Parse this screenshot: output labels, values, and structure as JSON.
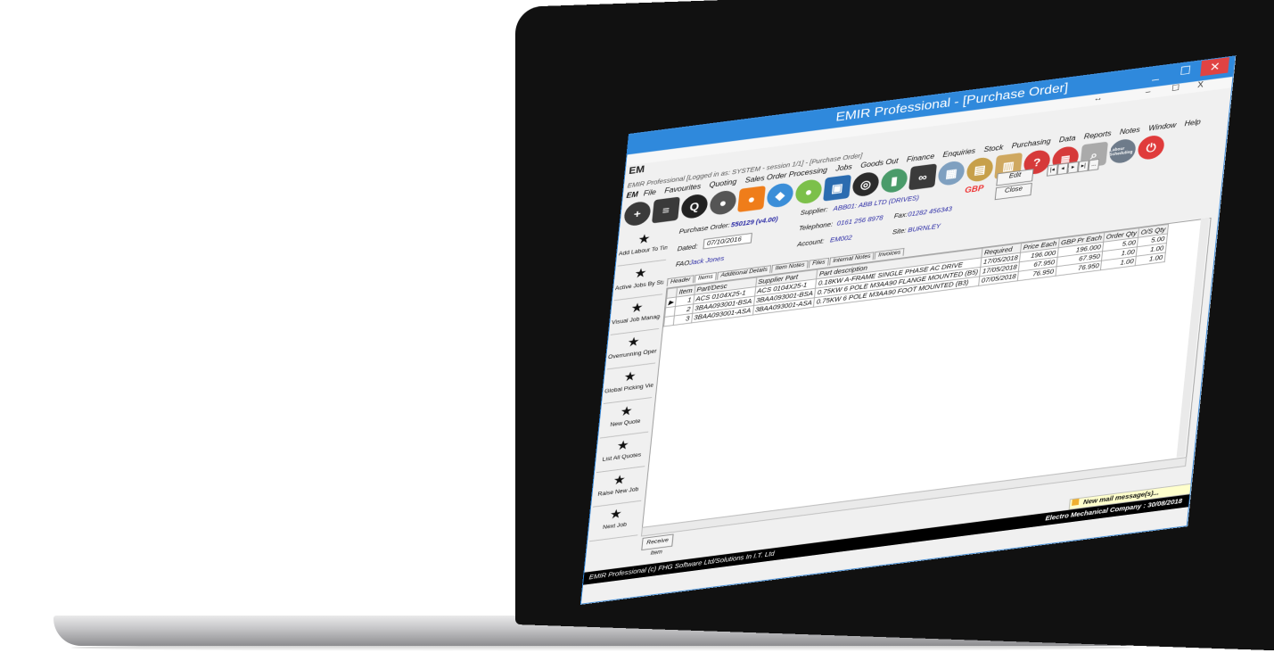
{
  "window": {
    "title": "EMIR Professional - [Purchase Order]",
    "controls": [
      "_",
      "☐",
      "✕"
    ],
    "inner_controls": [
      "↔",
      "–",
      "☐",
      "X"
    ],
    "session_info": "EMIR Professional [Logged in as: SYSTEM - session 1/1] - [Purchase Order]",
    "logo_text": "EM"
  },
  "menu": [
    "File",
    "Favourites",
    "Quoting",
    "Sales Order Processing",
    "Jobs",
    "Goods Out",
    "Finance",
    "Enquiries",
    "Stock",
    "Purchasing",
    "Data",
    "Reports",
    "Notes",
    "Window",
    "Help"
  ],
  "toolbar": {
    "colors": [
      "#3a3a3a",
      "#3a3a3a",
      "#222",
      "#555",
      "#ef7d1a",
      "#3b8ed8",
      "#7cc04a",
      "#2b6cb0",
      "#2b2b2b",
      "#4a9b6a",
      "#3a3a3a",
      "#7fa0c0",
      "#c7a04a",
      "#cfa860",
      "#d63a3a",
      "#d63a3a",
      "#aaaaaa",
      "#6e7b8a",
      "#e03b3b"
    ],
    "glyphs": [
      "+",
      "≡",
      "Q",
      "●",
      "●",
      "◆",
      "●",
      "▣",
      "◎",
      "▮",
      "∞",
      "▦",
      "▤",
      "▥",
      "?",
      "≣",
      "⌕",
      "▪",
      "⏻"
    ],
    "scheduling_label": "Labour Scheduling"
  },
  "header": {
    "purchase_order_label": "Purchase Order:",
    "purchase_order_value": "550129 (v4.00)",
    "dated_label": "Dated:",
    "dated_value": "07/10/2016",
    "fao_label": "FAO:",
    "fao_value": "Jack Jones",
    "supplier_label": "Supplier:",
    "supplier_value": "ABB01: ABB LTD (DRIVES)",
    "telephone_label": "Telephone:",
    "telephone_value": "0161 256 8978",
    "fax_label": "Fax:",
    "fax_value": "01282 456343",
    "account_label": "Account:",
    "account_value": "EM002",
    "site_label": "Site:",
    "site_value": "BURNLEY",
    "currency": "GBP",
    "edit_label": "Edit",
    "close_label": "Close",
    "nav": [
      "|◂",
      "◂",
      "▸",
      "▸|",
      "..."
    ]
  },
  "sidebar": [
    {
      "label": "Add Labour To Tim..."
    },
    {
      "label": "Active Jobs By Stat..."
    },
    {
      "label": "Visual Job Manage..."
    },
    {
      "label": "Overrunning Operati..."
    },
    {
      "label": "Global Picking View"
    },
    {
      "label": "New Quote"
    },
    {
      "label": "List All Quotes"
    },
    {
      "label": "Raise New Job"
    },
    {
      "label": "Next Job"
    }
  ],
  "tabs": [
    "Header",
    "Items",
    "Additional Details",
    "Item Notes",
    "Files",
    "Internal Notes",
    "Invoices"
  ],
  "grid": {
    "columns": [
      "Item",
      "Part/Desc",
      "Supplier Part",
      "Part description",
      "Required",
      "Price Each",
      "GBP Pr Each",
      "Order Qty",
      "O/S Qty"
    ],
    "rows": [
      [
        "1",
        "ACS 0104X25-1",
        "ACS 0104X25-1",
        "0.18KW A-FRAME SINGLE PHASE AC DRIVE",
        "17/05/2018",
        "196.000",
        "196.000",
        "5.00",
        "5.00"
      ],
      [
        "2",
        "3BAA093001-BSA",
        "3BAA093001-BSA",
        "0.75KW 6 POLE M3AA90 FLANGE MOUNTED (B5)",
        "17/05/2018",
        "67.950",
        "67.950",
        "1.00",
        "1.00"
      ],
      [
        "3",
        "3BAA093001-ASA",
        "3BAA093001-ASA",
        "0.75KW 6 POLE M3AA90 FOOT MOUNTED (B3)",
        "07/05/2018",
        "76.950",
        "76.950",
        "1.00",
        "1.00"
      ]
    ]
  },
  "receive_label": "Receive Item",
  "mail_message": "New mail message(s)...",
  "status": {
    "left": "EMIR Professional (c) FHG Software Ltd/Solutions In I.T. Ltd",
    "right": "Electro Mechanical Company : 30/08/2018"
  }
}
